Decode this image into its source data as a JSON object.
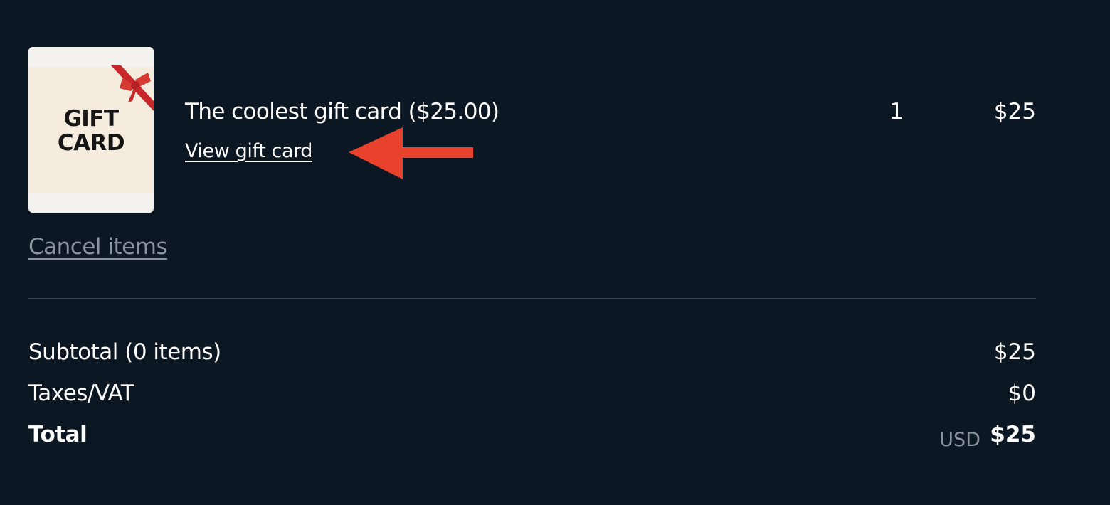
{
  "item": {
    "thumbnail_text_line1": "GIFT",
    "thumbnail_text_line2": "CARD",
    "title": "The coolest gift card ($25.00)",
    "view_link": "View gift card",
    "quantity": "1",
    "price": "$25"
  },
  "cancel_link": "Cancel items",
  "summary": {
    "subtotal_label": "Subtotal (0 items)",
    "subtotal_value": "$25",
    "taxes_label": "Taxes/VAT",
    "taxes_value": "$0",
    "total_label": "Total",
    "currency": "USD",
    "total_value": "$25"
  },
  "colors": {
    "background": "#0c1724",
    "annotation_arrow": "#e8412c",
    "muted_text": "#8b939c",
    "ribbon": "#c9282a"
  }
}
